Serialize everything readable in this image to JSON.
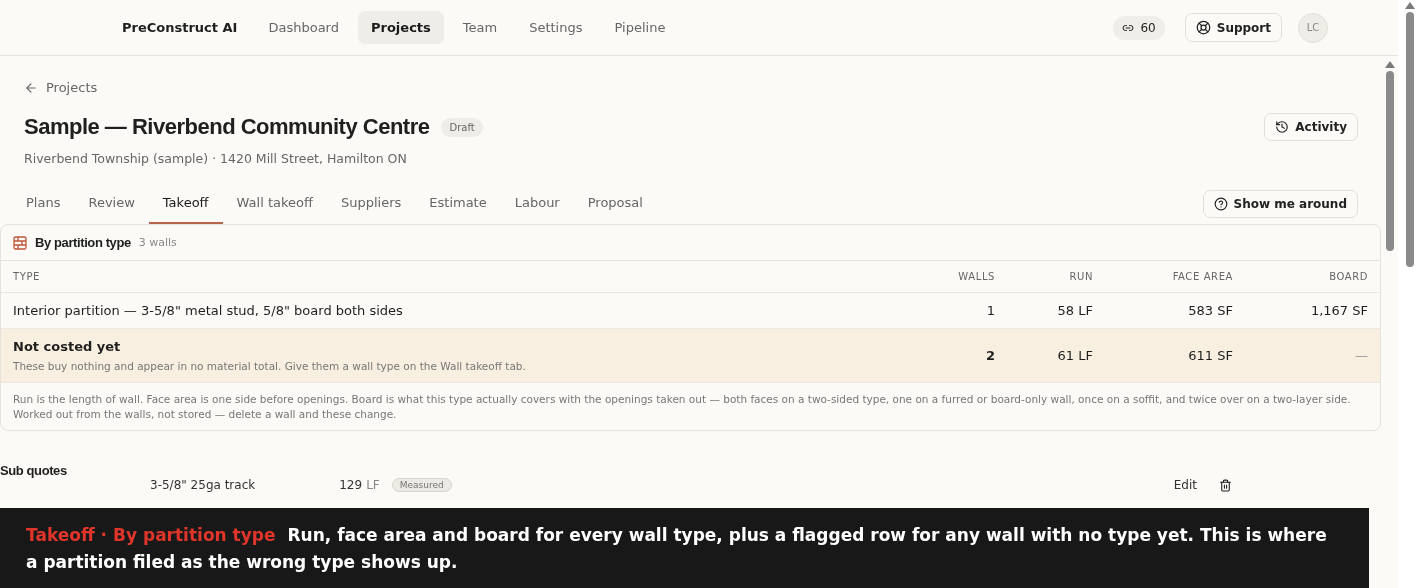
{
  "nav": {
    "brand": "PreConstruct AI",
    "items": [
      {
        "label": "Dashboard",
        "selected": false
      },
      {
        "label": "Projects",
        "selected": true
      },
      {
        "label": "Team",
        "selected": false
      },
      {
        "label": "Settings",
        "selected": false
      },
      {
        "label": "Pipeline",
        "selected": false
      }
    ],
    "credits": "60",
    "support": "Support",
    "avatar": "LC"
  },
  "back_link": "Projects",
  "project": {
    "title": "Sample — Riverbend Community Centre",
    "status": "Draft",
    "subtitle": "Riverbend Township (sample) · 1420 Mill Street, Hamilton ON",
    "activity_button": "Activity"
  },
  "tabs": [
    {
      "label": "Plans",
      "selected": false
    },
    {
      "label": "Review",
      "selected": false
    },
    {
      "label": "Takeoff",
      "selected": true
    },
    {
      "label": "Wall takeoff",
      "selected": false
    },
    {
      "label": "Suppliers",
      "selected": false
    },
    {
      "label": "Estimate",
      "selected": false
    },
    {
      "label": "Labour",
      "selected": false
    },
    {
      "label": "Proposal",
      "selected": false
    }
  ],
  "tour_button": "Show me around",
  "table": {
    "title": "By partition type",
    "count": "3 walls",
    "columns": [
      "TYPE",
      "WALLS",
      "RUN",
      "FACE AREA",
      "BOARD"
    ],
    "rows": [
      {
        "kind": "normal",
        "type": "Interior partition — 3-5/8\" metal stud, 5/8\" board both sides",
        "walls": "1",
        "run": "58 LF",
        "face_area": "583 SF",
        "board": "1,167 SF"
      },
      {
        "kind": "flagged",
        "type": "Not costed yet",
        "note": "These buy nothing and appear in no material total. Give them a wall type on the Wall takeoff tab.",
        "walls": "2",
        "run": "61 LF",
        "face_area": "611 SF",
        "board": "—"
      }
    ],
    "footnote": "Run is the length of wall. Face area is one side before openings. Board is what this type actually covers with the openings taken out — both faces on a two-sided type, one on a furred or board-only wall, once on a soffit, and twice over on a two-layer side. Worked out from the walls, not stored — delete a wall and these change."
  },
  "sub_quotes": {
    "title": "Sub quotes",
    "item": "3-5/8\" 25ga track",
    "quantity": "129",
    "unit": "LF",
    "status": "Measured",
    "edit": "Edit"
  },
  "caption": {
    "title": "Takeoff · By partition type",
    "text": "Run, face area and board for every wall type, plus a flagged row for any wall with no type yet. This is where a partition filed as the wrong type shows up."
  }
}
